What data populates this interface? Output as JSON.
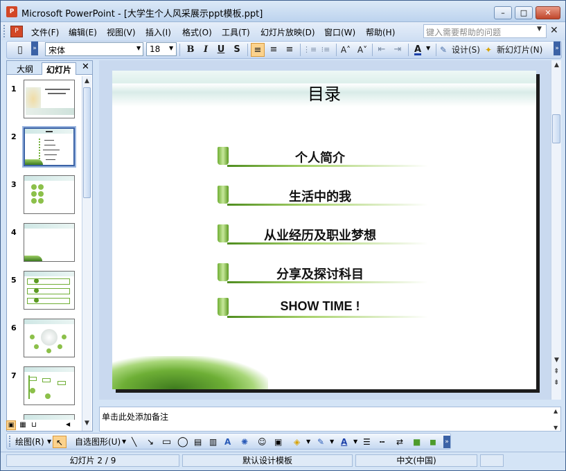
{
  "window": {
    "title": "Microsoft PowerPoint - [大学生个人风采展示ppt模板.ppt]",
    "app_icon": "P",
    "minimize": "–",
    "maximize": "□",
    "close": "✕"
  },
  "menu": {
    "items": [
      "文件(F)",
      "编辑(E)",
      "视图(V)",
      "插入(I)",
      "格式(O)",
      "工具(T)",
      "幻灯片放映(D)",
      "窗口(W)",
      "帮助(H)"
    ],
    "help_placeholder": "键入需要帮助的问题",
    "close": "✕"
  },
  "toolbar": {
    "font": "宋体",
    "size": "18",
    "bold": "B",
    "italic": "I",
    "underline": "U",
    "shadow": "S",
    "align_left": "≡",
    "align_center": "≡",
    "align_right": "≡",
    "numbered": "⋮≡",
    "bulleted": "⁝≡",
    "grow": "A˄",
    "shrink": "A˅",
    "dec_indent": "⇤",
    "inc_indent": "⇥",
    "font_color": "A",
    "design": "设计(S)",
    "new_slide": "新幻灯片(N)"
  },
  "left_pane": {
    "tab_outline": "大纲",
    "tab_slides": "幻灯片",
    "close": "✕",
    "slides": [
      "1",
      "2",
      "3",
      "4",
      "5",
      "6",
      "7"
    ],
    "selected": "2"
  },
  "slide": {
    "title": "目录",
    "items": [
      "个人简介",
      "生活中的我",
      "从业经历及职业梦想",
      "分享及探讨科目",
      "SHOW  TIME !"
    ]
  },
  "notes": {
    "placeholder": "单击此处添加备注"
  },
  "draw_toolbar": {
    "draw": "绘图(R)",
    "autoshapes": "自选图形(U)"
  },
  "status": {
    "slide_counter": "幻灯片 2 / 9",
    "template": "默认设计模板",
    "language": "中文(中国)"
  },
  "colors": {
    "accent_green": "#6fae34",
    "window_blue": "#d4e4f6",
    "selected_orange": "#fbd28d"
  }
}
